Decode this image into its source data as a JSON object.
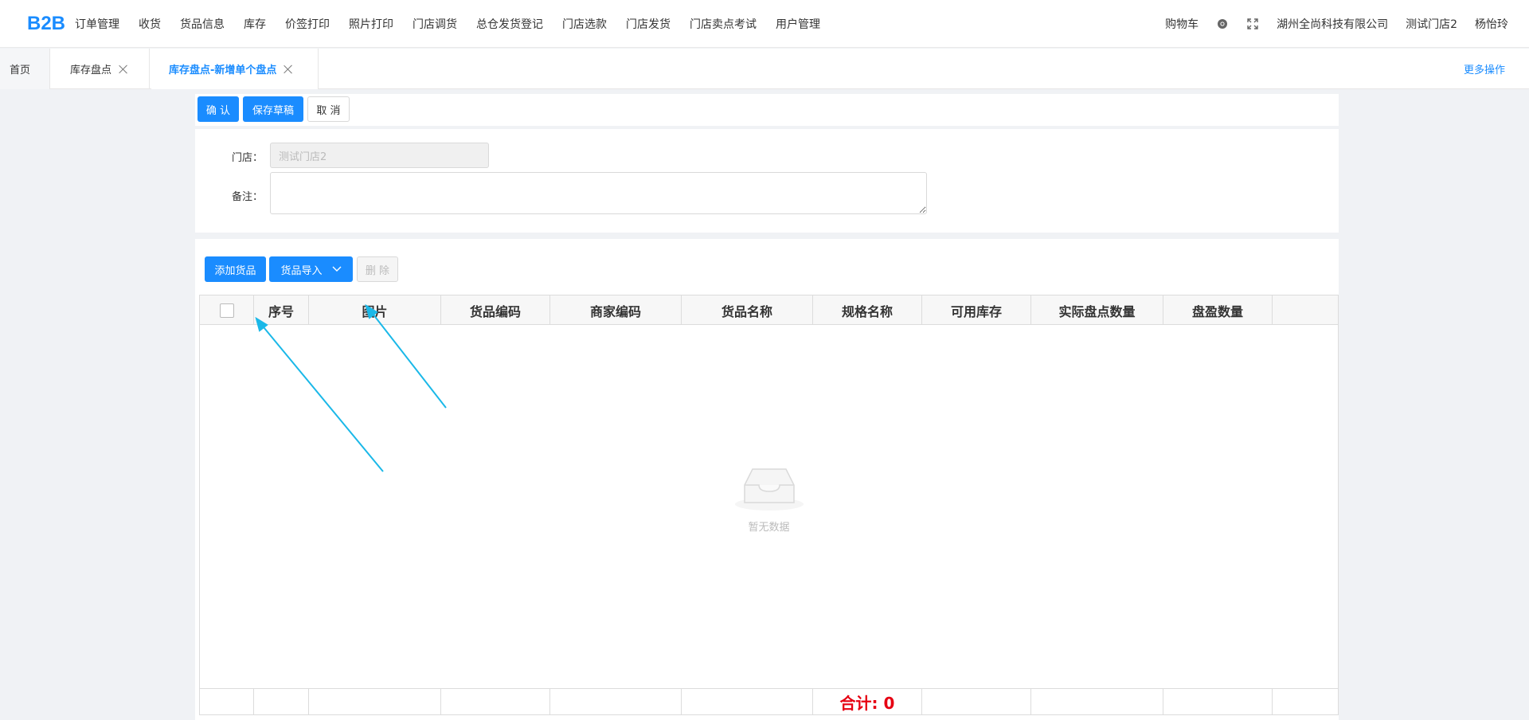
{
  "nav": {
    "logo": "B2B",
    "menu": [
      "订单管理",
      "收货",
      "货品信息",
      "库存",
      "价签打印",
      "照片打印",
      "门店调货",
      "总仓发货登记",
      "门店选款",
      "门店发货",
      "门店卖点考试",
      "用户管理"
    ],
    "cart": "购物车",
    "company": "湖州全尚科技有限公司",
    "store": "测试门店2",
    "user": "杨怡玲"
  },
  "tabs": {
    "home": "首页",
    "items": [
      "库存盘点",
      "库存盘点-新增单个盘点"
    ],
    "more": "更多操作"
  },
  "actions": {
    "confirm": "确 认",
    "save_draft": "保存草稿",
    "cancel": "取 消"
  },
  "form": {
    "store_label": "门店：",
    "store_value": "测试门店2",
    "note_label": "备注：",
    "note_value": ""
  },
  "grid_toolbar": {
    "add": "添加货品",
    "import": "货品导入",
    "delete": "删 除"
  },
  "table": {
    "columns": [
      "序号",
      "图片",
      "货品编码",
      "商家编码",
      "货品名称",
      "规格名称",
      "可用库存",
      "实际盘点数量",
      "盘盈数量"
    ],
    "rows": [],
    "empty_text": "暂无数据",
    "total_label": "合计: 0"
  },
  "colors": {
    "primary": "#1a8cff",
    "total": "#e60012",
    "annotation_arrow": "#1ab8e8"
  }
}
